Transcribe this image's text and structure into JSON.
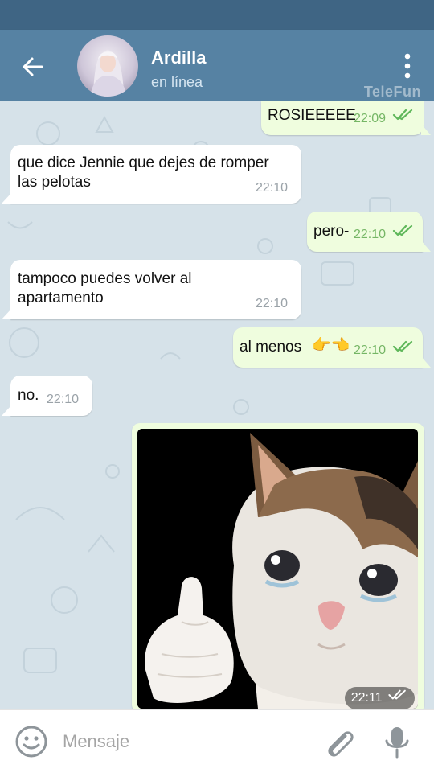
{
  "header": {
    "contact_name": "Ardilla",
    "status": "en línea",
    "watermark": "TeleFun"
  },
  "messages": [
    {
      "direction": "out",
      "text": "ROSIEEEEE",
      "time": "22:09",
      "ticks": "read"
    },
    {
      "direction": "in",
      "line1": "que dice Jennie que dejes de romper",
      "line2": "las pelotas",
      "time": "22:10"
    },
    {
      "direction": "out",
      "text": "pero-",
      "time": "22:10",
      "ticks": "read"
    },
    {
      "direction": "in",
      "line1": "tampoco puedes volver al",
      "line2": "apartamento",
      "time": "22:10"
    },
    {
      "direction": "out",
      "text": "al menos",
      "emoji": "👉👈",
      "time": "22:10",
      "ticks": "read"
    },
    {
      "direction": "in",
      "text": "no.",
      "time": "22:10"
    },
    {
      "direction": "out",
      "type": "sticker",
      "sticker": "crying-cat-thumbs-up",
      "time": "22:11",
      "ticks": "read"
    }
  ],
  "composer": {
    "placeholder": "Mensaje"
  },
  "colors": {
    "header": "#5682a3",
    "statusbar": "#3f6584",
    "outgoing_bubble": "#effdde",
    "incoming_bubble": "#ffffff",
    "read_ticks": "#5fb75a",
    "chat_background": "#d6e2e9"
  }
}
